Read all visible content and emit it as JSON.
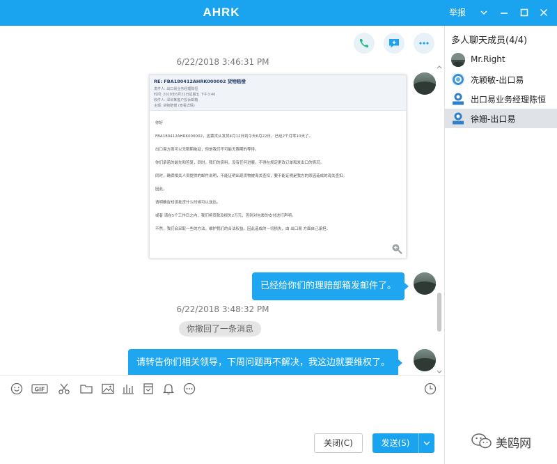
{
  "window": {
    "title": "AHRK",
    "report_label": "举报"
  },
  "colors": {
    "accent": "#1aa3ef",
    "bubble": "#1ea7f0",
    "active_member_bg": "#dfe3e8"
  },
  "chat_actions": [
    "phone-icon",
    "message-icon",
    "more-icon"
  ],
  "messages": {
    "timestamp_1": "6/22/2018 3:46:31 PM",
    "email": {
      "subject": "RE: FBA180412AHRK000002 货物赔偿",
      "meta_1": "发件人: 出口易业务经理陈恒",
      "meta_2": "时间: 2018年6月22日星期五 下午3:46",
      "meta_3": "收件人: 深圳某客户投诉邮箱",
      "meta_4": "主题: 货物赔偿 (查看详情)",
      "lines": [
        "你好",
        "FBA180412AHRK000002，这票货从发货4月12日到今天6月22日，已经2个月零10天了。",
        "出口易方面可以无限期拖延，但是我们不可能无限期的等待。",
        "你们承诺的最先和答复，同时，我们的资料，没有任何进展，不得在规定更改订单和发出口的情况。",
        "同时，确保相关人员提供的邮件说明，不能证明出现货物被海关查扣，要不能证明是我方的原因造成的海关查扣。",
        "因此，",
        "请明确告知该批货什么时候可以送达。",
        "或者 请在5个工作日之内，我们将货款及损失2万元，否则对包裹的支付进行声明。",
        "不然，我们会采取一些的方法，维护我们的合法权益。因此造成的一切损失，由 出口易 方面自己承担。"
      ]
    },
    "bubble_1": "已经给你们的理赔部箱发邮件了。",
    "timestamp_2": "6/22/2018 3:48:32 PM",
    "recall_notice": "你撤回了一条消息",
    "bubble_2": "请转告你们相关领导，下周问题再不解决，我这边就要维权了。"
  },
  "toolbar": {
    "tools": [
      "emoji-icon",
      "gif-icon",
      "scissors-icon",
      "folder-icon",
      "image-icon",
      "chart-icon",
      "calendar-icon",
      "bell-icon",
      "more-circle-icon"
    ],
    "history_icon": "clock-icon"
  },
  "actions": {
    "close_label": "关闭(C)",
    "send_label": "发送(S)"
  },
  "members": {
    "title": "多人聊天成员(4/4)",
    "items": [
      {
        "name": "Mr.Right",
        "active": false
      },
      {
        "name": "冼颖敏-出口易",
        "active": false
      },
      {
        "name": "出口易业务经理陈恒",
        "active": false
      },
      {
        "name": "徐姗-出口易",
        "active": true
      }
    ]
  },
  "watermark": {
    "text": "美鸥网"
  }
}
